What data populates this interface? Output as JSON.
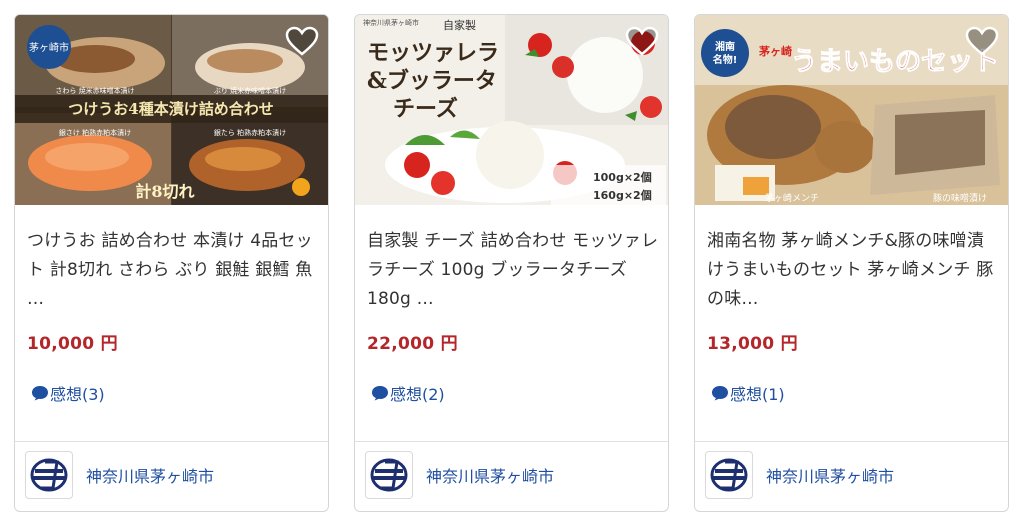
{
  "products": [
    {
      "title": "つけうお 詰め合わせ 本漬け 4品セット 計8切れ さわら ぶり 銀鮭 銀鱈 魚 …",
      "price": "10,000 円",
      "reviews": "感想(3)",
      "city": "神奈川県茅ヶ崎市",
      "image_text": {
        "badge": "茅ヶ崎市",
        "banner": "つけうお4種本漬け詰め合わせ",
        "labels": [
          "さわら 焼米赤味噌本漬け",
          "ぶり 焼米赤味噌本漬け",
          "銀さけ 粕熟赤粕本漬け",
          "銀たら 粕熟赤粕本漬け"
        ],
        "count": "計8切れ"
      }
    },
    {
      "title": "自家製 チーズ 詰め合わせ モッツァレラチーズ 100g ブッラータチーズ180g …",
      "price": "22,000 円",
      "reviews": "感想(2)",
      "city": "神奈川県茅ヶ崎市",
      "image_text": {
        "small": "神奈川県茅ヶ崎市",
        "tag": "自家製",
        "line1": "モッツァレラ",
        "line2": "&ブッラータ",
        "line3": "チーズ",
        "qty1": "100g×2個",
        "qty2": "160g×2個"
      }
    },
    {
      "title": "湘南名物 茅ヶ崎メンチ&豚の味噌漬けうまいものセット 茅ヶ崎メンチ 豚の味…",
      "price": "13,000 円",
      "reviews": "感想(1)",
      "city": "神奈川県茅ヶ崎市",
      "image_text": {
        "badge1": "湘南",
        "badge2": "名物!",
        "chigasaki": "茅ヶ崎",
        "headline": "うまいものセット",
        "label_left": "茅ヶ崎メンチ",
        "label_right": "豚の味噌漬け"
      }
    }
  ],
  "colors": {
    "price": "#b3262a",
    "link": "#1f4fa0",
    "border": "#d6d6d6"
  }
}
